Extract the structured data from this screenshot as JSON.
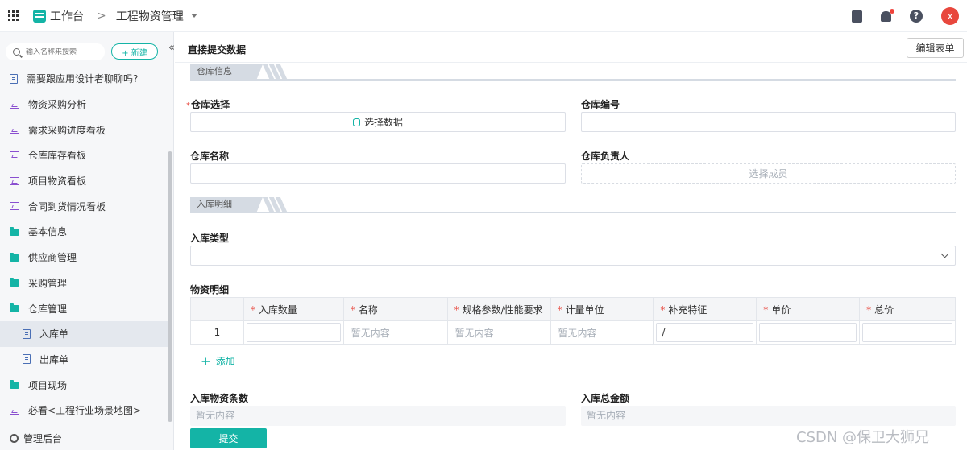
{
  "topbar": {
    "workspace": "工作台",
    "separator": ">",
    "app_name": "工程物资管理",
    "avatar_letter": "x"
  },
  "sidebar": {
    "search_placeholder": "输入名称来搜索",
    "new_label": "+ 新建",
    "collapse": "«",
    "items": [
      {
        "label": "需要跟应用设计者聊聊吗?",
        "icon": "document-icon",
        "sub": false,
        "active": false
      },
      {
        "label": "物资采购分析",
        "icon": "dashboard-icon",
        "sub": false,
        "active": false
      },
      {
        "label": "需求采购进度看板",
        "icon": "dashboard-icon",
        "sub": false,
        "active": false
      },
      {
        "label": "仓库库存看板",
        "icon": "dashboard-icon",
        "sub": false,
        "active": false
      },
      {
        "label": "项目物资看板",
        "icon": "dashboard-icon",
        "sub": false,
        "active": false
      },
      {
        "label": "合同到货情况看板",
        "icon": "dashboard-icon",
        "sub": false,
        "active": false
      },
      {
        "label": "基本信息",
        "icon": "folder-icon",
        "sub": false,
        "active": false
      },
      {
        "label": "供应商管理",
        "icon": "folder-icon",
        "sub": false,
        "active": false
      },
      {
        "label": "采购管理",
        "icon": "folder-icon",
        "sub": false,
        "active": false
      },
      {
        "label": "仓库管理",
        "icon": "folder-icon",
        "sub": false,
        "active": false
      },
      {
        "label": "入库单",
        "icon": "document-icon",
        "sub": true,
        "active": true
      },
      {
        "label": "出库单",
        "icon": "document-icon",
        "sub": true,
        "active": false
      },
      {
        "label": "项目现场",
        "icon": "folder-icon",
        "sub": false,
        "active": false
      },
      {
        "label": "必看<工程行业场景地图>",
        "icon": "dashboard-icon",
        "sub": false,
        "active": false
      }
    ],
    "admin_label": "管理后台"
  },
  "form": {
    "title": "直接提交数据",
    "edit_button": "编辑表单",
    "section_warehouse": "仓库信息",
    "section_inbound": "入库明细",
    "warehouse_select_label": "仓库选择",
    "warehouse_select_button": "选择数据",
    "warehouse_code_label": "仓库编号",
    "warehouse_name_label": "仓库名称",
    "warehouse_manager_label": "仓库负责人",
    "select_member": "选择成员",
    "inbound_type_label": "入库类型",
    "material_detail_label": "物资明细",
    "table": {
      "headers": [
        "入库数量",
        "名称",
        "规格参数/性能要求",
        "计量单位",
        "补充特征",
        "单价",
        "总价"
      ],
      "row_number": "1",
      "empty_text": "暂无内容",
      "feature_value": "/"
    },
    "add_label": "添加",
    "count_label": "入库物资条数",
    "amount_label": "入库总金额",
    "empty_text": "暂无内容",
    "submit_label": "提交"
  },
  "watermark": "CSDN @保卫大狮兄",
  "colors": {
    "accent": "#14b4a6",
    "required": "#e8473d",
    "avatar": "#e8473d"
  }
}
